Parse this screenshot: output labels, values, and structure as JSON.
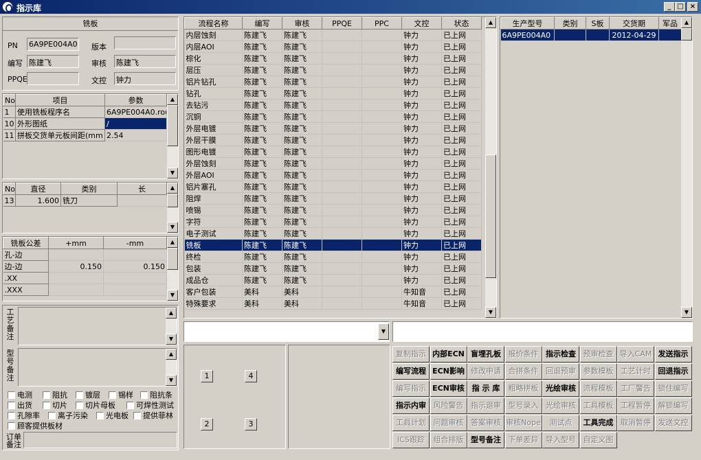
{
  "window": {
    "title": "指示库"
  },
  "left": {
    "section_title": "铣板",
    "pn_label": "PN",
    "pn_value": "6A9PE004A0",
    "version_label": "版本",
    "version_value": "",
    "author_label": "编写",
    "author_value": "陈建飞",
    "review_label": "审核",
    "review_value": "陈建飞",
    "ppqe_label": "PPQE",
    "ppqe_value": "",
    "doc_label": "文控",
    "doc_value": "钟力",
    "params": {
      "headers": [
        "No",
        "项目",
        "参数"
      ],
      "rows": [
        [
          "1",
          "使用铣板程序名",
          "6A9PE004A0.rou"
        ],
        [
          "10",
          "外形图纸",
          "/"
        ],
        [
          "11",
          "拼板交货单元板间距(mm",
          "2.54"
        ]
      ]
    },
    "tools": {
      "headers": [
        "No",
        "直径",
        "类别",
        "长"
      ],
      "rows": [
        [
          "13",
          "1.600",
          "铣刀",
          ""
        ]
      ]
    },
    "tolerance": {
      "headers": [
        "铣板公差",
        "+mm",
        "-mm"
      ],
      "rows": [
        [
          "孔-边",
          "",
          ""
        ],
        [
          "边-边",
          "0.150",
          "0.150"
        ],
        [
          ".XX",
          "",
          ""
        ],
        [
          ".XXX",
          "",
          ""
        ]
      ]
    },
    "process_note_label": "工艺备注",
    "model_note_label": "型号备注",
    "order_note_label": "订单备注",
    "checks": [
      "电测",
      "阻抗",
      "镀层",
      "锡样",
      "阻抗条",
      "出货",
      "切片",
      "切片母板",
      "可焊性测试",
      "孔隙率",
      "离子污染",
      "光电板",
      "提供菲林",
      "顾客提供板材"
    ]
  },
  "flow": {
    "headers": [
      "流程名称",
      "编写",
      "审核",
      "PPQE",
      "PPC",
      "文控",
      "状态"
    ],
    "rows": [
      [
        "内层蚀刻",
        "陈建飞",
        "陈建飞",
        "",
        "",
        "钟力",
        "已上网"
      ],
      [
        "内层AOI",
        "陈建飞",
        "陈建飞",
        "",
        "",
        "钟力",
        "已上网"
      ],
      [
        "棕化",
        "陈建飞",
        "陈建飞",
        "",
        "",
        "钟力",
        "已上网"
      ],
      [
        "层压",
        "陈建飞",
        "陈建飞",
        "",
        "",
        "钟力",
        "已上网"
      ],
      [
        "铝片钻孔",
        "陈建飞",
        "陈建飞",
        "",
        "",
        "钟力",
        "已上网"
      ],
      [
        "钻孔",
        "陈建飞",
        "陈建飞",
        "",
        "",
        "钟力",
        "已上网"
      ],
      [
        "去钻污",
        "陈建飞",
        "陈建飞",
        "",
        "",
        "钟力",
        "已上网"
      ],
      [
        "沉铜",
        "陈建飞",
        "陈建飞",
        "",
        "",
        "钟力",
        "已上网"
      ],
      [
        "外层电镀",
        "陈建飞",
        "陈建飞",
        "",
        "",
        "钟力",
        "已上网"
      ],
      [
        "外层干膜",
        "陈建飞",
        "陈建飞",
        "",
        "",
        "钟力",
        "已上网"
      ],
      [
        "图形电镀",
        "陈建飞",
        "陈建飞",
        "",
        "",
        "钟力",
        "已上网"
      ],
      [
        "外层蚀刻",
        "陈建飞",
        "陈建飞",
        "",
        "",
        "钟力",
        "已上网"
      ],
      [
        "外层AOI",
        "陈建飞",
        "陈建飞",
        "",
        "",
        "钟力",
        "已上网"
      ],
      [
        "铝片塞孔",
        "陈建飞",
        "陈建飞",
        "",
        "",
        "钟力",
        "已上网"
      ],
      [
        "阻焊",
        "陈建飞",
        "陈建飞",
        "",
        "",
        "钟力",
        "已上网"
      ],
      [
        "喷锡",
        "陈建飞",
        "陈建飞",
        "",
        "",
        "钟力",
        "已上网"
      ],
      [
        "字符",
        "陈建飞",
        "陈建飞",
        "",
        "",
        "钟力",
        "已上网"
      ],
      [
        "电子测试",
        "陈建飞",
        "陈建飞",
        "",
        "",
        "钟力",
        "已上网"
      ],
      [
        "铣板",
        "陈建飞",
        "陈建飞",
        "",
        "",
        "钟力",
        "已上网"
      ],
      [
        "终检",
        "陈建飞",
        "陈建飞",
        "",
        "",
        "钟力",
        "已上网"
      ],
      [
        "包装",
        "陈建飞",
        "陈建飞",
        "",
        "",
        "钟力",
        "已上网"
      ],
      [
        "成品仓",
        "陈建飞",
        "陈建飞",
        "",
        "",
        "钟力",
        "已上网"
      ],
      [
        "客户包装",
        "美科",
        "美科",
        "",
        "",
        "牛知音",
        "已上网"
      ],
      [
        "特殊要求",
        "美科",
        "美科",
        "",
        "",
        "牛知音",
        "已上网"
      ]
    ],
    "selected_index": 18
  },
  "product": {
    "headers": [
      "生产型号",
      "类别",
      "S板",
      "交货期",
      "军品"
    ],
    "rows": [
      [
        "6A9PE004A0",
        "",
        "",
        "2012-04-29",
        ""
      ]
    ]
  },
  "numbers": [
    "1",
    "4",
    "2",
    "3"
  ],
  "buttons": [
    [
      {
        "t": "复制指示",
        "e": false
      },
      {
        "t": "内部ECN",
        "e": true
      },
      {
        "t": "盲埋孔板",
        "e": true
      },
      {
        "t": "报价条件",
        "e": false
      },
      {
        "t": "指示检查",
        "e": true
      },
      {
        "t": "预审检查",
        "e": false
      },
      {
        "t": "导入CAM",
        "e": false
      },
      {
        "t": "发送指示",
        "e": true
      }
    ],
    [
      {
        "t": "编写流程",
        "e": true
      },
      {
        "t": "ECN影响",
        "e": true
      },
      {
        "t": "修改申请",
        "e": false
      },
      {
        "t": "合拼条件",
        "e": false
      },
      {
        "t": "回退预审",
        "e": false
      },
      {
        "t": "参数模板",
        "e": false
      },
      {
        "t": "工艺计时",
        "e": false
      },
      {
        "t": "回退指示",
        "e": true
      }
    ],
    [
      {
        "t": "编写指示",
        "e": false
      },
      {
        "t": "ECN审核",
        "e": true
      },
      {
        "t": "指 示 库",
        "e": true
      },
      {
        "t": "粗略拼板",
        "e": false
      },
      {
        "t": "光绘审核",
        "e": true
      },
      {
        "t": "流程模板",
        "e": false
      },
      {
        "t": "工厂警告",
        "e": false
      },
      {
        "t": "锁住编写",
        "e": false
      }
    ],
    [
      {
        "t": "指示内审",
        "e": true
      },
      {
        "t": "风险警告",
        "e": false
      },
      {
        "t": "指示退审",
        "e": false
      },
      {
        "t": "型号录入",
        "e": false
      },
      {
        "t": "光绘审核",
        "e": false
      },
      {
        "t": "工具模板",
        "e": false
      },
      {
        "t": "工程暂停",
        "e": false
      },
      {
        "t": "解锁编写",
        "e": false
      }
    ],
    [
      {
        "t": "工具计划",
        "e": false
      },
      {
        "t": "问题审核",
        "e": false
      },
      {
        "t": "答案审核",
        "e": false
      },
      {
        "t": "审核Nope",
        "e": false
      },
      {
        "t": "测试点",
        "e": false
      },
      {
        "t": "工具完成",
        "e": true
      },
      {
        "t": "取消暂停",
        "e": false
      },
      {
        "t": "发送文控",
        "e": false
      }
    ],
    [
      {
        "t": "ICS跟踪",
        "e": false
      },
      {
        "t": "组合排版",
        "e": false
      },
      {
        "t": "型号备注",
        "e": true
      },
      {
        "t": "下单差异",
        "e": false
      },
      {
        "t": "导入型号",
        "e": false
      },
      {
        "t": "自定义图",
        "e": false
      }
    ]
  ]
}
